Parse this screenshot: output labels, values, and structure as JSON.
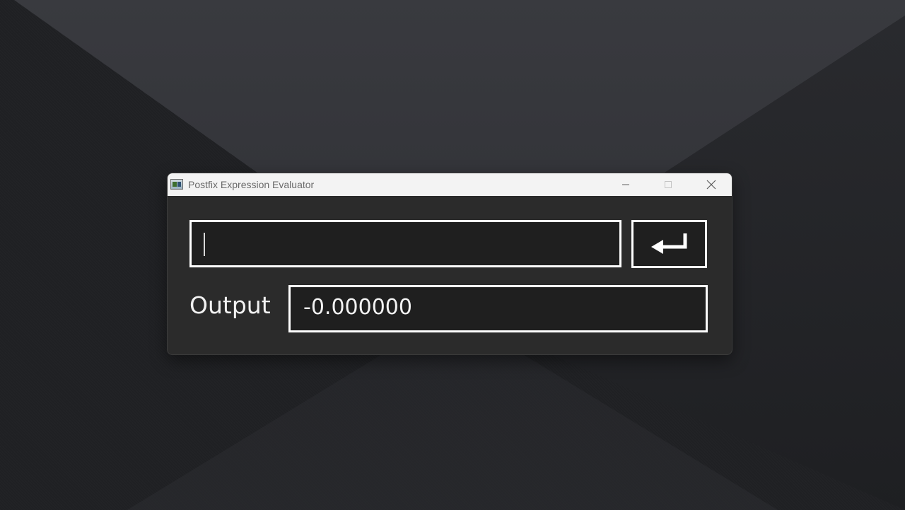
{
  "window": {
    "title": "Postfix Expression Evaluator"
  },
  "caption_buttons": {
    "minimize_icon": "minimize-icon",
    "maximize_icon": "maximize-icon",
    "close_icon": "close-icon"
  },
  "expression_input": {
    "value": "",
    "placeholder": ""
  },
  "enter_button": {
    "icon": "enter-return-arrow-icon"
  },
  "output": {
    "label": "Output",
    "value": "-0.000000"
  },
  "colors": {
    "panel_background": "#2b2b2b",
    "field_background": "#1f1f1f",
    "field_border": "#ffffff",
    "titlebar_background": "#f3f3f3"
  }
}
